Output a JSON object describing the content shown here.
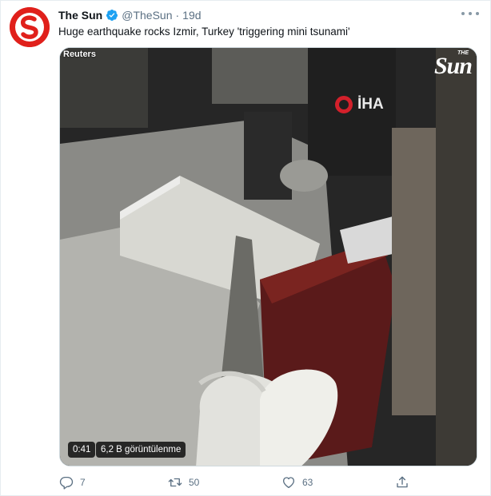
{
  "tweet": {
    "author_name": "The Sun",
    "handle": "@TheSun",
    "separator": "·",
    "time": "19d",
    "text": "Huge earthquake rocks Izmir, Turkey 'triggering mini tsunami'",
    "verified": true,
    "avatar_icon": "the-sun-logo",
    "brand_color": "#e0201b"
  },
  "media": {
    "source_label": "Reuters",
    "watermark_the": "THE",
    "watermark_sun": "Sun",
    "agency_label": "İHA",
    "duration": "0:41",
    "views": "6,2 B görüntülenme"
  },
  "actions": {
    "replies": "7",
    "retweets": "50",
    "likes": "63",
    "reply_icon": "reply-icon",
    "retweet_icon": "retweet-icon",
    "like_icon": "heart-icon",
    "share_icon": "share-icon"
  }
}
